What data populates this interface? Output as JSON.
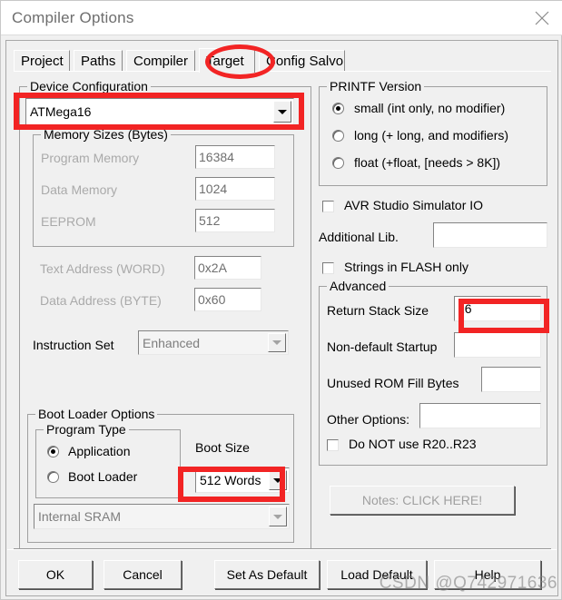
{
  "window": {
    "title": "Compiler Options",
    "close_icon": "close-icon"
  },
  "tabs": [
    {
      "label": "Project",
      "selected": false
    },
    {
      "label": "Paths",
      "selected": false
    },
    {
      "label": "Compiler",
      "selected": false
    },
    {
      "label": "Target",
      "selected": true
    },
    {
      "label": "Config Salvo",
      "selected": false
    }
  ],
  "device_configuration": {
    "group_label": "Device Configuration",
    "device_value": "ATMega16",
    "memory_sizes": {
      "group_label": "Memory Sizes (Bytes)",
      "program_memory_label": "Program Memory",
      "program_memory_value": "16384",
      "data_memory_label": "Data Memory",
      "data_memory_value": "1024",
      "eeprom_label": "EEPROM",
      "eeprom_value": "512"
    },
    "text_address_label": "Text Address (WORD)",
    "text_address_value": "0x2A",
    "data_address_label": "Data Address (BYTE)",
    "data_address_value": "0x60",
    "instruction_set_label": "Instruction Set",
    "instruction_set_value": "Enhanced",
    "boot_loader": {
      "group_label": "Boot Loader Options",
      "program_type": {
        "group_label": "Program Type",
        "options": [
          {
            "label": "Application",
            "checked": true
          },
          {
            "label": "Boot Loader",
            "checked": false
          }
        ]
      },
      "boot_size_label": "Boot Size",
      "boot_size_value": "512 Words",
      "memory_value": "Internal SRAM"
    }
  },
  "printf_version": {
    "group_label": "PRINTF Version",
    "options": [
      {
        "label": "small (int only, no modifier)",
        "checked": true
      },
      {
        "label": "long (+ long, and modifiers)",
        "checked": false
      },
      {
        "label": "float (+float, [needs > 8K])",
        "checked": false
      }
    ]
  },
  "misc": {
    "avr_sim_io_label": "AVR Studio Simulator IO",
    "avr_sim_io_checked": false,
    "additional_lib_label": "Additional Lib.",
    "additional_lib_value": "",
    "strings_flash_label": "Strings in FLASH only",
    "strings_flash_checked": false
  },
  "advanced": {
    "group_label": "Advanced",
    "return_stack_label": "Return Stack Size",
    "return_stack_value": "16",
    "non_default_startup_label": "Non-default Startup",
    "non_default_startup_value": "",
    "unused_rom_label": "Unused ROM Fill Bytes",
    "unused_rom_value": "",
    "other_options_label": "Other Options:",
    "other_options_value": "",
    "do_not_use_label": "Do NOT use R20..R23",
    "do_not_use_checked": false
  },
  "notes_button": "Notes: CLICK HERE!",
  "buttons": {
    "ok": "OK",
    "cancel": "Cancel",
    "set_as_default": "Set As Default",
    "load_default": "Load Default",
    "help": "Help"
  },
  "watermark": "CSDN @Q742971636",
  "colors": {
    "annotation": "#f22424",
    "dialog_bg": "#f0f0f0",
    "titlebar_bg": "#ffffff",
    "disabled_text": "#aaaaaa"
  }
}
